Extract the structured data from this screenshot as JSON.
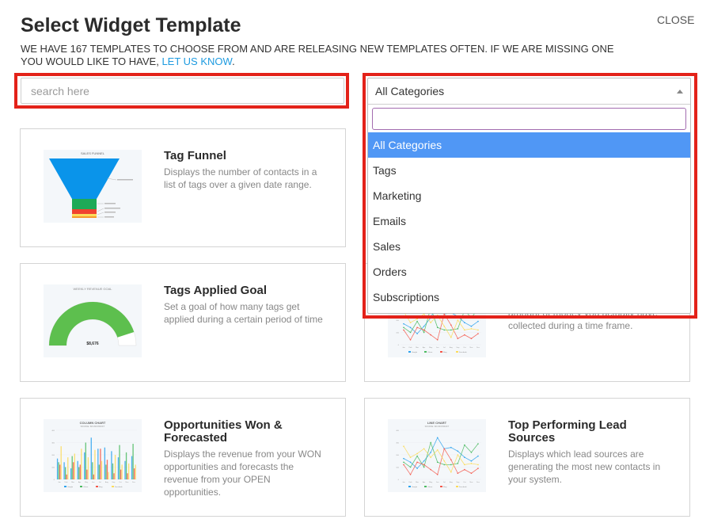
{
  "header": {
    "title": "Select Widget Template",
    "close_label": "CLOSE",
    "subtitle_text": "WE HAVE 167 TEMPLATES TO CHOOSE FROM AND ARE RELEASING NEW TEMPLATES OFTEN. IF WE ARE MISSING ONE YOU WOULD LIKE TO HAVE, ",
    "subtitle_link": "LET US KNOW",
    "subtitle_end": "."
  },
  "search": {
    "placeholder": "search here",
    "value": ""
  },
  "category_select": {
    "selected": "All Categories",
    "filter_value": "",
    "options": [
      "All Categories",
      "Tags",
      "Marketing",
      "Emails",
      "Sales",
      "Orders",
      "Subscriptions"
    ],
    "highlighted_index": 0
  },
  "highlight_color": "#e32219",
  "templates": [
    {
      "title": "Tag Funnel",
      "description": "Displays the number of contacts in a list of tags over a given date range.",
      "thumbnail": {
        "type": "funnel",
        "label": "SALES FUNNEL"
      }
    },
    {
      "title": "Tags Applied Goal",
      "description": "Set a goal of how many tags get applied during a certain period of time",
      "thumbnail": {
        "type": "gauge",
        "label": "WEEKLY REVENUE GOAL",
        "value_text": "$8,676",
        "fill_fraction": 0.9
      }
    },
    {
      "title": "",
      "description": "amount of money you actually have collected during a time frame.",
      "thumbnail": {
        "type": "line"
      }
    },
    {
      "title": "Opportunities Won & Forecasted",
      "description": "Displays the revenue from your WON opportunities and forecasts the revenue from your OPEN opportunities.",
      "thumbnail": {
        "type": "column",
        "label": "COLUMN CHART",
        "sublabel": "SOURCE: INFUSIONSOFT"
      }
    },
    {
      "title": "Top Performing Lead Sources",
      "description": "Displays which lead sources are generating the most new contacts in your system.",
      "thumbnail": {
        "type": "line",
        "label": "LINE CHART",
        "sublabel": "SOURCE: INFUSIONSOFT"
      }
    }
  ],
  "thumb_series": {
    "months": [
      "Jan",
      "Feb",
      "Mar",
      "Apr",
      "May",
      "Jun",
      "Jul",
      "Aug",
      "Sep",
      "Oct",
      "Nov",
      "Dec"
    ],
    "legend": [
      "Google",
      "Yahoo",
      "Bing",
      "Facebook"
    ],
    "colors": [
      "#2ea3ee",
      "#4cbb62",
      "#f4574a",
      "#fbdc5a"
    ],
    "google": [
      170,
      140,
      90,
      150,
      220,
      340,
      250,
      260,
      230,
      180,
      150,
      190
    ],
    "yahoo": [
      140,
      100,
      190,
      100,
      300,
      140,
      120,
      120,
      130,
      280,
      220,
      290
    ],
    "bing": [
      120,
      40,
      140,
      120,
      80,
      40,
      250,
      160,
      50,
      80,
      50,
      90
    ],
    "facebook": [
      270,
      180,
      210,
      250,
      180,
      240,
      150,
      60,
      200,
      120,
      130,
      120
    ],
    "ymax": 400
  }
}
